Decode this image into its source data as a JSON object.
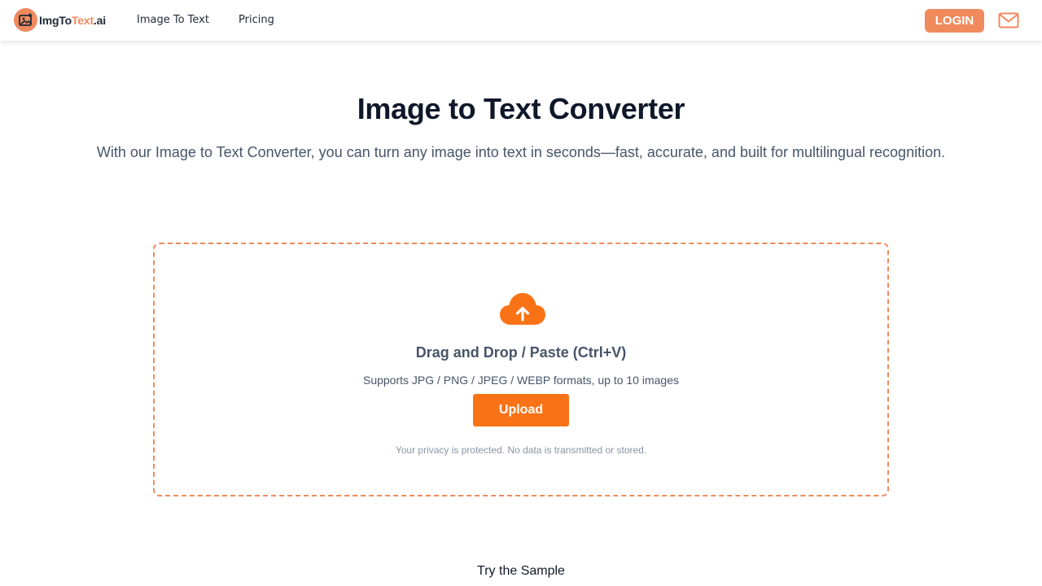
{
  "brand": {
    "logo_prefix": "ImgTo",
    "logo_middle": "Text",
    "logo_suffix": ".ai",
    "accent_color": "#f08a5d",
    "icon": "image-logo-icon"
  },
  "nav": {
    "links": [
      {
        "label": "Image To Text"
      },
      {
        "label": "Pricing"
      }
    ],
    "login_label": "LOGIN",
    "mail_icon": "mail-icon"
  },
  "hero": {
    "title": "Image to Text Converter",
    "subtitle": "With our Image to Text Converter, you can turn any image into text in seconds—fast, accurate, and built for multilingual recognition."
  },
  "dropzone": {
    "icon": "cloud-upload-icon",
    "title": "Drag and Drop / Paste (Ctrl+V)",
    "formats": "Supports JPG / PNG / JPEG / WEBP formats, up to 10 images",
    "upload_label": "Upload",
    "privacy": "Your privacy is protected. No data is transmitted or stored.",
    "button_color": "#f97316"
  },
  "sample": {
    "label": "Try the Sample"
  }
}
